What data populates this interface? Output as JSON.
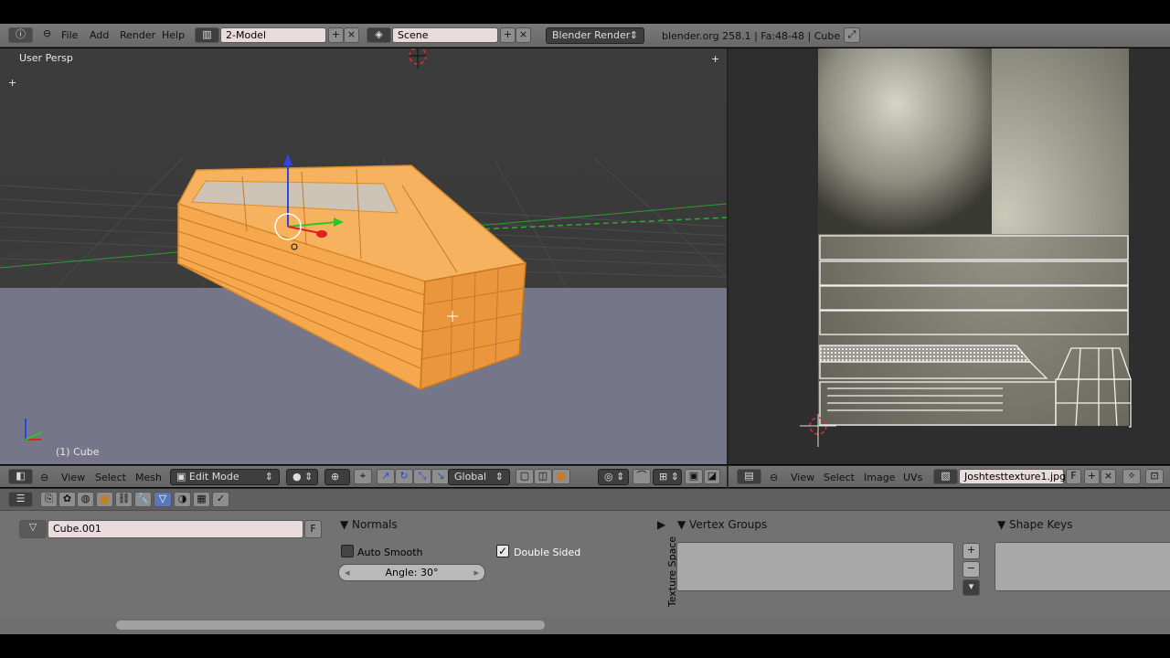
{
  "header": {
    "menu": [
      "File",
      "Add",
      "Render",
      "Help"
    ],
    "screen_layout": "2-Model",
    "scene": "Scene",
    "render_engine": "Blender Render",
    "stats": "blender.org 258.1 | Fa:48-48 | Cube"
  },
  "viewport": {
    "view_label": "User Persp",
    "object_label": "(1) Cube",
    "menu": [
      "View",
      "Select",
      "Mesh"
    ],
    "mode": "Edit Mode",
    "orientation": "Global"
  },
  "uv_editor": {
    "menu": [
      "View",
      "Select",
      "Image",
      "UVs"
    ],
    "image_name": "Joshtesttexture1.jpg",
    "fake_user": "F"
  },
  "properties": {
    "mesh_name": "Cube.001",
    "fake_user": "F",
    "normals_title": "Normals",
    "auto_smooth_label": "Auto Smooth",
    "auto_smooth_checked": false,
    "double_sided_label": "Double Sided",
    "double_sided_checked": true,
    "angle_field": "Angle: 30°",
    "texture_space_label": "Texture Space",
    "vertex_groups_title": "Vertex Groups",
    "shape_keys_title": "Shape Keys"
  },
  "colors": {
    "selection_orange": "#f7a84a",
    "x_axis": "#e02020",
    "y_axis": "#22cc22",
    "z_axis": "#2d46e0"
  }
}
